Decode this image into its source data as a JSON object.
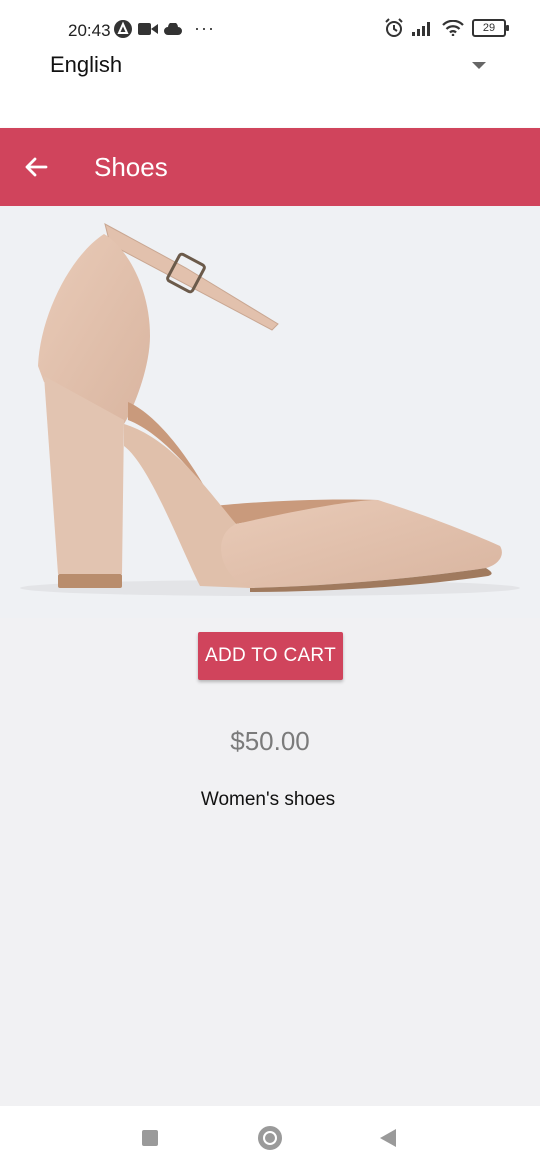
{
  "status_bar": {
    "time": "20:43",
    "dots": "···",
    "battery": "29"
  },
  "language": {
    "selected": "English"
  },
  "app_bar": {
    "title": "Shoes",
    "color": "#d0445c"
  },
  "product": {
    "add_to_cart_label": "ADD TO CART",
    "price": "$50.00",
    "description": "Women's shoes"
  },
  "icons": {
    "back": "arrow-left-icon",
    "nav_recent": "square-icon",
    "nav_home": "circle-icon",
    "nav_back": "triangle-back-icon"
  }
}
